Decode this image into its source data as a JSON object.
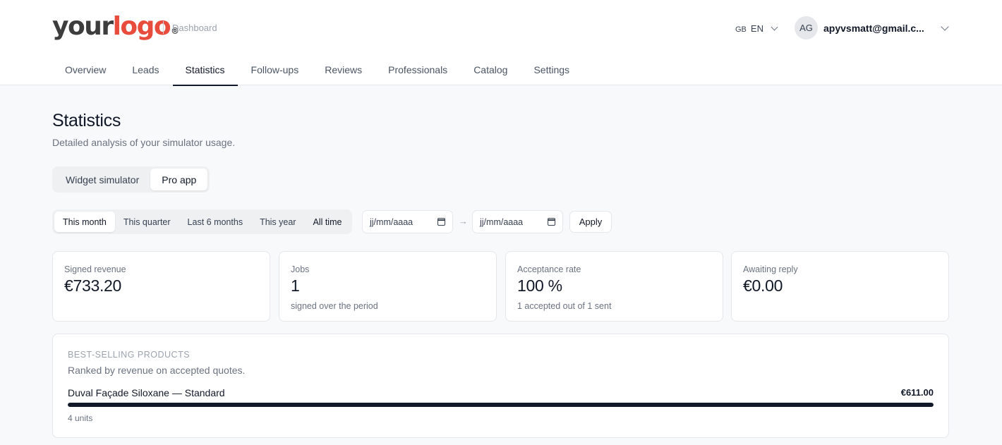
{
  "header": {
    "logo_your": "your",
    "logo_brand": "logo",
    "logo_reg": "®",
    "section_label": "Dashboard",
    "lang_flag": "GB",
    "lang_code": "EN",
    "user_initials": "AG",
    "user_email": "apyvsmatt@gmail.c..."
  },
  "nav": {
    "items": [
      "Overview",
      "Leads",
      "Statistics",
      "Follow-ups",
      "Reviews",
      "Professionals",
      "Catalog",
      "Settings"
    ],
    "active": "Statistics"
  },
  "page": {
    "title": "Statistics",
    "subtitle": "Detailed analysis of your simulator usage."
  },
  "source_tabs": {
    "items": [
      "Widget simulator",
      "Pro app"
    ],
    "active": "Pro app"
  },
  "period": {
    "items": [
      "This month",
      "This quarter",
      "Last 6 months",
      "This year",
      "All time"
    ],
    "active": "This month",
    "date_from_placeholder": "jj/mm/aaaa",
    "date_to_placeholder": "jj/mm/aaaa",
    "arrow": "→",
    "apply_label": "Apply"
  },
  "kpis": [
    {
      "label": "Signed revenue",
      "value": "€733.20",
      "sub": ""
    },
    {
      "label": "Jobs",
      "value": "1",
      "sub": "signed over the period"
    },
    {
      "label": "Acceptance rate",
      "value": "100 %",
      "sub": "1 accepted out of 1 sent"
    },
    {
      "label": "Awaiting reply",
      "value": "€0.00",
      "sub": ""
    }
  ],
  "best_sellers": {
    "title": "BEST-SELLING PRODUCTS",
    "subtitle": "Ranked by revenue on accepted quotes.",
    "items": [
      {
        "name": "Duval Façade Siloxane — Standard",
        "amount": "€611.00",
        "units": "4 units",
        "share": 1.0
      }
    ]
  },
  "colors": {
    "brand": "#e84c3d",
    "accent": "#111827",
    "background": "#f8f9fa"
  }
}
